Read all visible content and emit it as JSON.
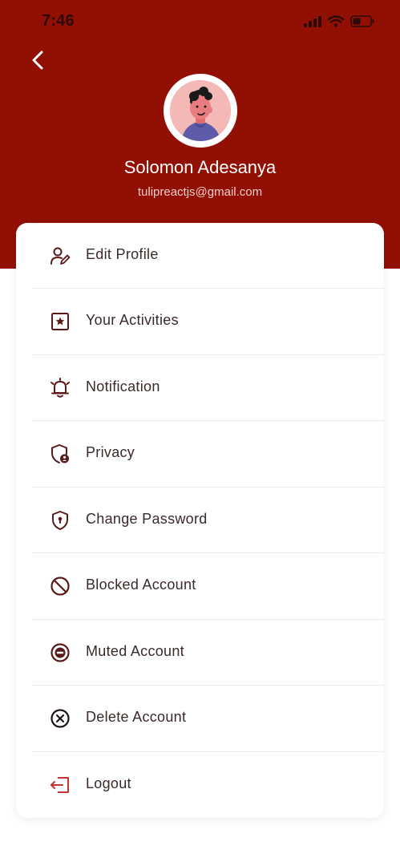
{
  "status_bar": {
    "time": "7:46"
  },
  "profile": {
    "name": "Solomon Adesanya",
    "email": "tulipreactjs@gmail.com"
  },
  "colors": {
    "header_bg": "#920f04",
    "icon_color": "#5a1a1a",
    "logout_icon": "#c73232"
  },
  "menu": {
    "items": [
      {
        "label": "Edit Profile",
        "icon": "edit-user-icon"
      },
      {
        "label": "Your Activities",
        "icon": "star-square-icon"
      },
      {
        "label": "Notification",
        "icon": "alarm-bell-icon"
      },
      {
        "label": "Privacy",
        "icon": "shield-user-icon"
      },
      {
        "label": "Change Password",
        "icon": "shield-keyhole-icon"
      },
      {
        "label": "Blocked Account",
        "icon": "block-icon"
      },
      {
        "label": "Muted Account",
        "icon": "mute-icon"
      },
      {
        "label": "Delete Account",
        "icon": "delete-circle-icon"
      },
      {
        "label": "Logout",
        "icon": "logout-icon"
      }
    ]
  }
}
